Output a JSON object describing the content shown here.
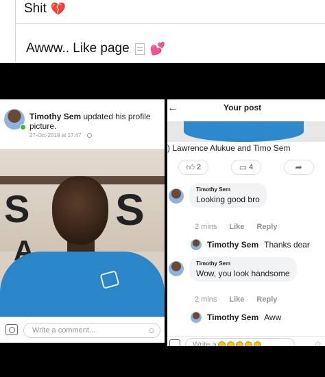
{
  "captions": {
    "line1": "Shit",
    "line1_emoji": "💔",
    "line2": "Awww.. Like page",
    "line2_emoji": "💕"
  },
  "left_post": {
    "author": "Timothy Sem",
    "action": "updated his profile picture.",
    "timestamp": "27-Oct-2019 at 17:47",
    "sign_letters": [
      "S",
      "S",
      "A"
    ],
    "comment_placeholder": "Write a comment..."
  },
  "right_post": {
    "header_title": "Your post",
    "tagged_text": "Lawrence Alukue and Timo Sem",
    "reactions": {
      "likes": "2",
      "comments": "4"
    },
    "comments": [
      {
        "author": "Timothy Sem",
        "text": "Looking good bro",
        "time": "2 mins",
        "like_label": "Like",
        "reply_label": "Reply",
        "reply": {
          "author": "Timothy Sem",
          "text": "Thanks dear"
        }
      },
      {
        "author": "Timothy Sem",
        "text": "Wow, you look handsome",
        "time": "2 mins",
        "like_label": "Like",
        "reply_label": "Reply",
        "reply": {
          "author": "Timothy Sem",
          "text": "Aww"
        }
      }
    ],
    "comment_placeholder": "Write a"
  },
  "colors": {
    "online": "#42b72a",
    "shirt": "#2a86c8",
    "bubble": "#f2f3f5"
  }
}
